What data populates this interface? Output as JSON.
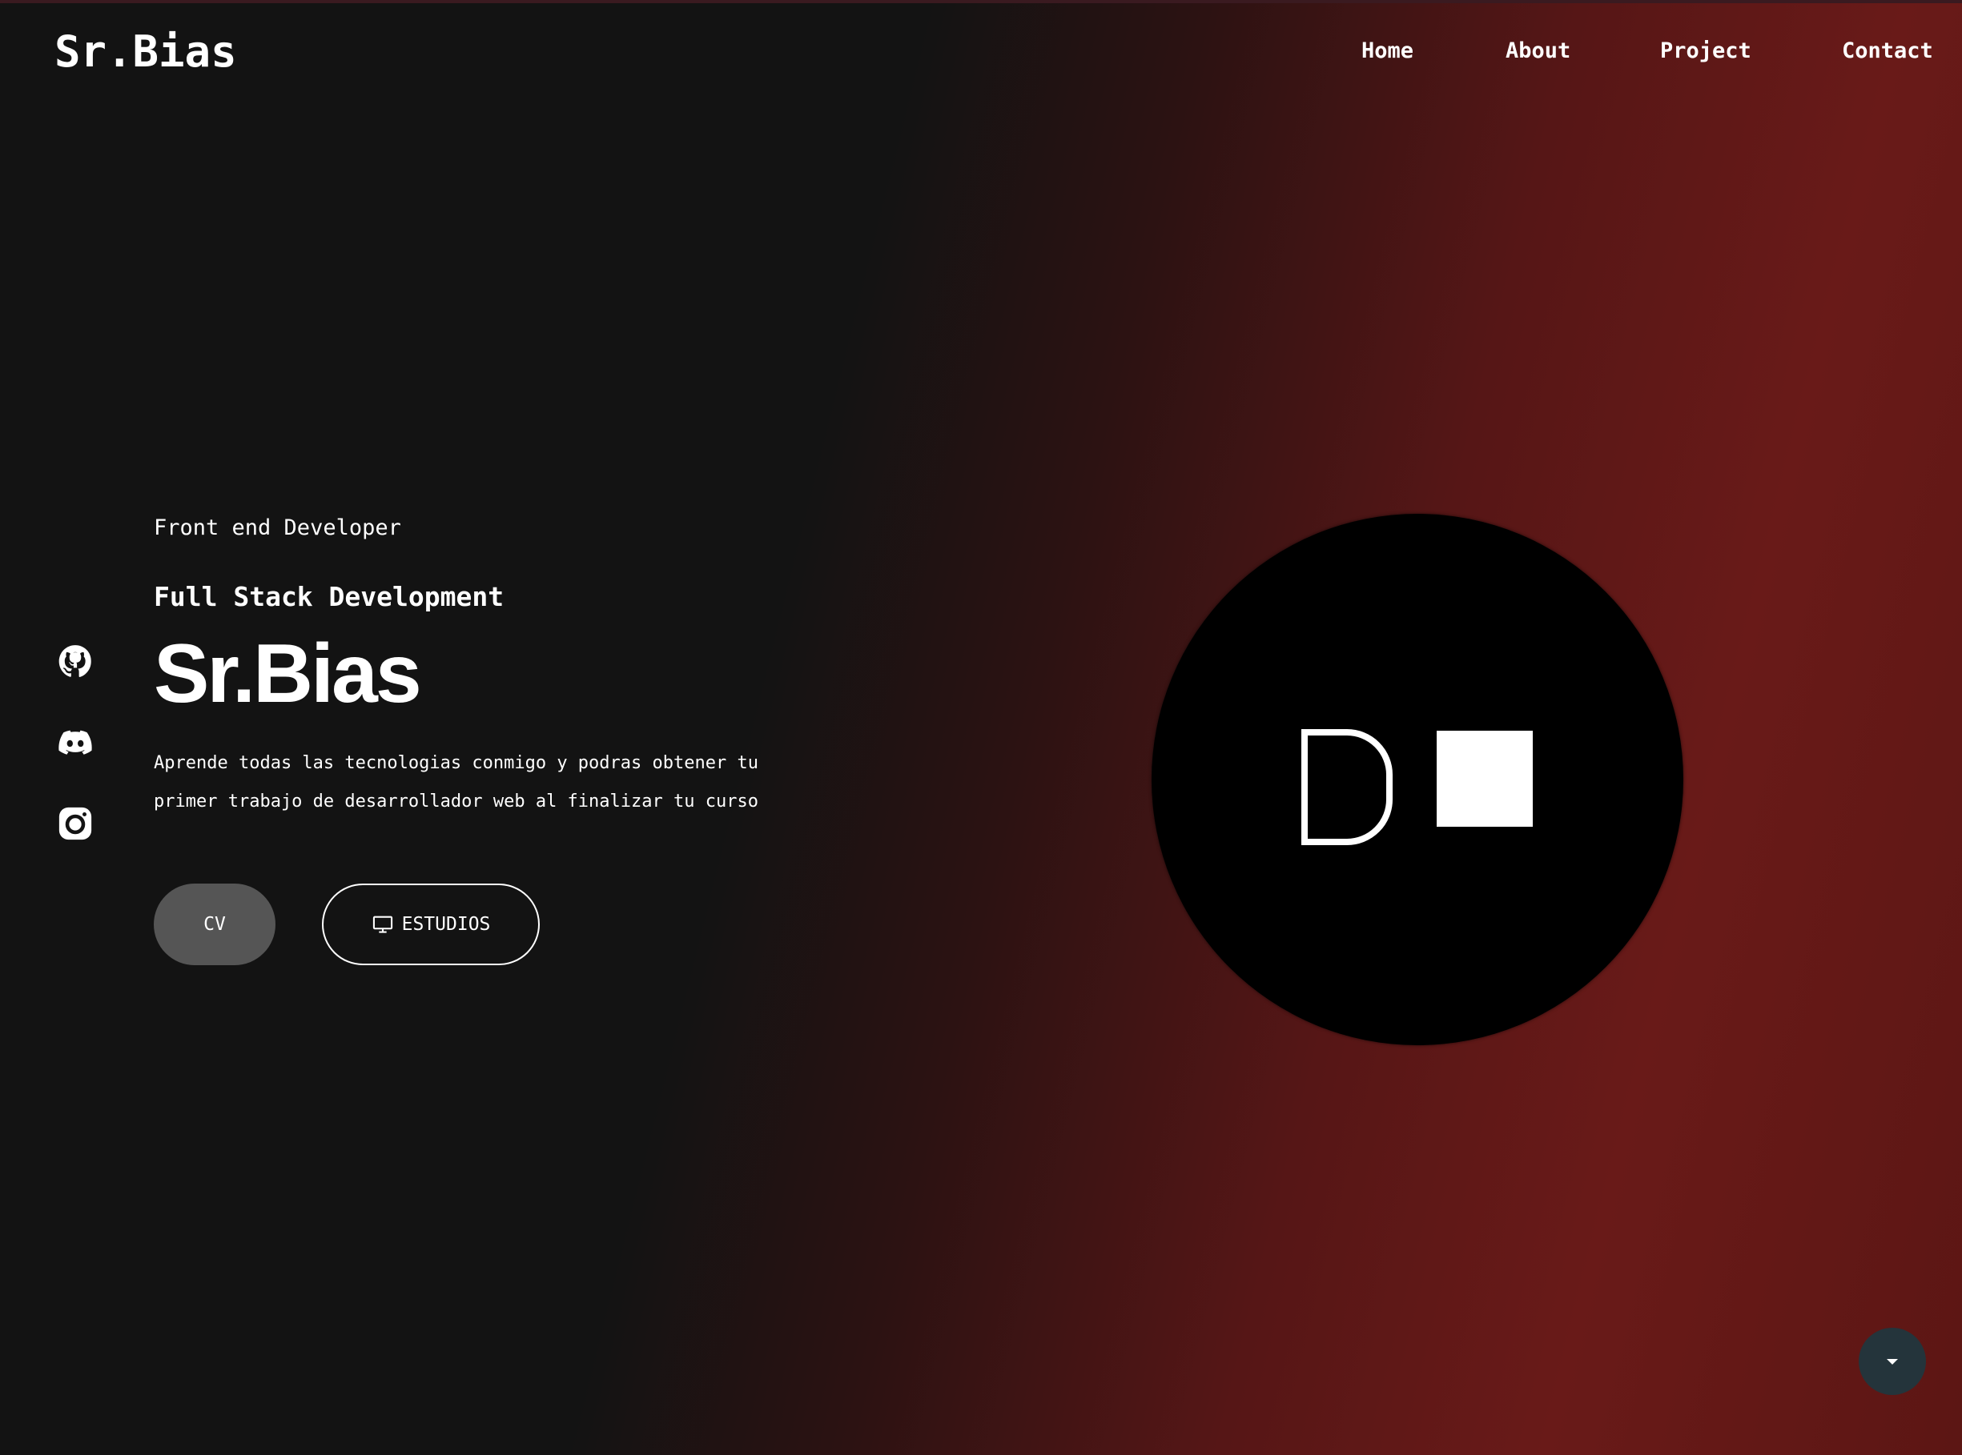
{
  "brand": {
    "logo_text": "Sr.Bias"
  },
  "nav": {
    "items": [
      {
        "label": "Home"
      },
      {
        "label": "About"
      },
      {
        "label": "Project"
      },
      {
        "label": "Contact"
      }
    ]
  },
  "social": {
    "icons": [
      "github-icon",
      "discord-icon",
      "instagram-icon"
    ]
  },
  "hero": {
    "subtitle": "Front end Developer",
    "tagline": "Full Stack Development",
    "name": "Sr.Bias",
    "description_line1": "Aprende todas las tecnologias conmigo y podras obtener tu",
    "description_line2": "primer trabajo de desarrollador web al finalizar tu curso",
    "cv_label": "CV",
    "estudios_label": "ESTUDIOS",
    "estudios_icon": "monitor-icon"
  },
  "avatar": {
    "icon": "dm-logo"
  },
  "scroll": {
    "icon": "caret-down-icon"
  },
  "colors": {
    "background_dark": "#131313",
    "background_red": "#691a18",
    "cv_button": "#555555",
    "scroll_button": "#24343b"
  }
}
